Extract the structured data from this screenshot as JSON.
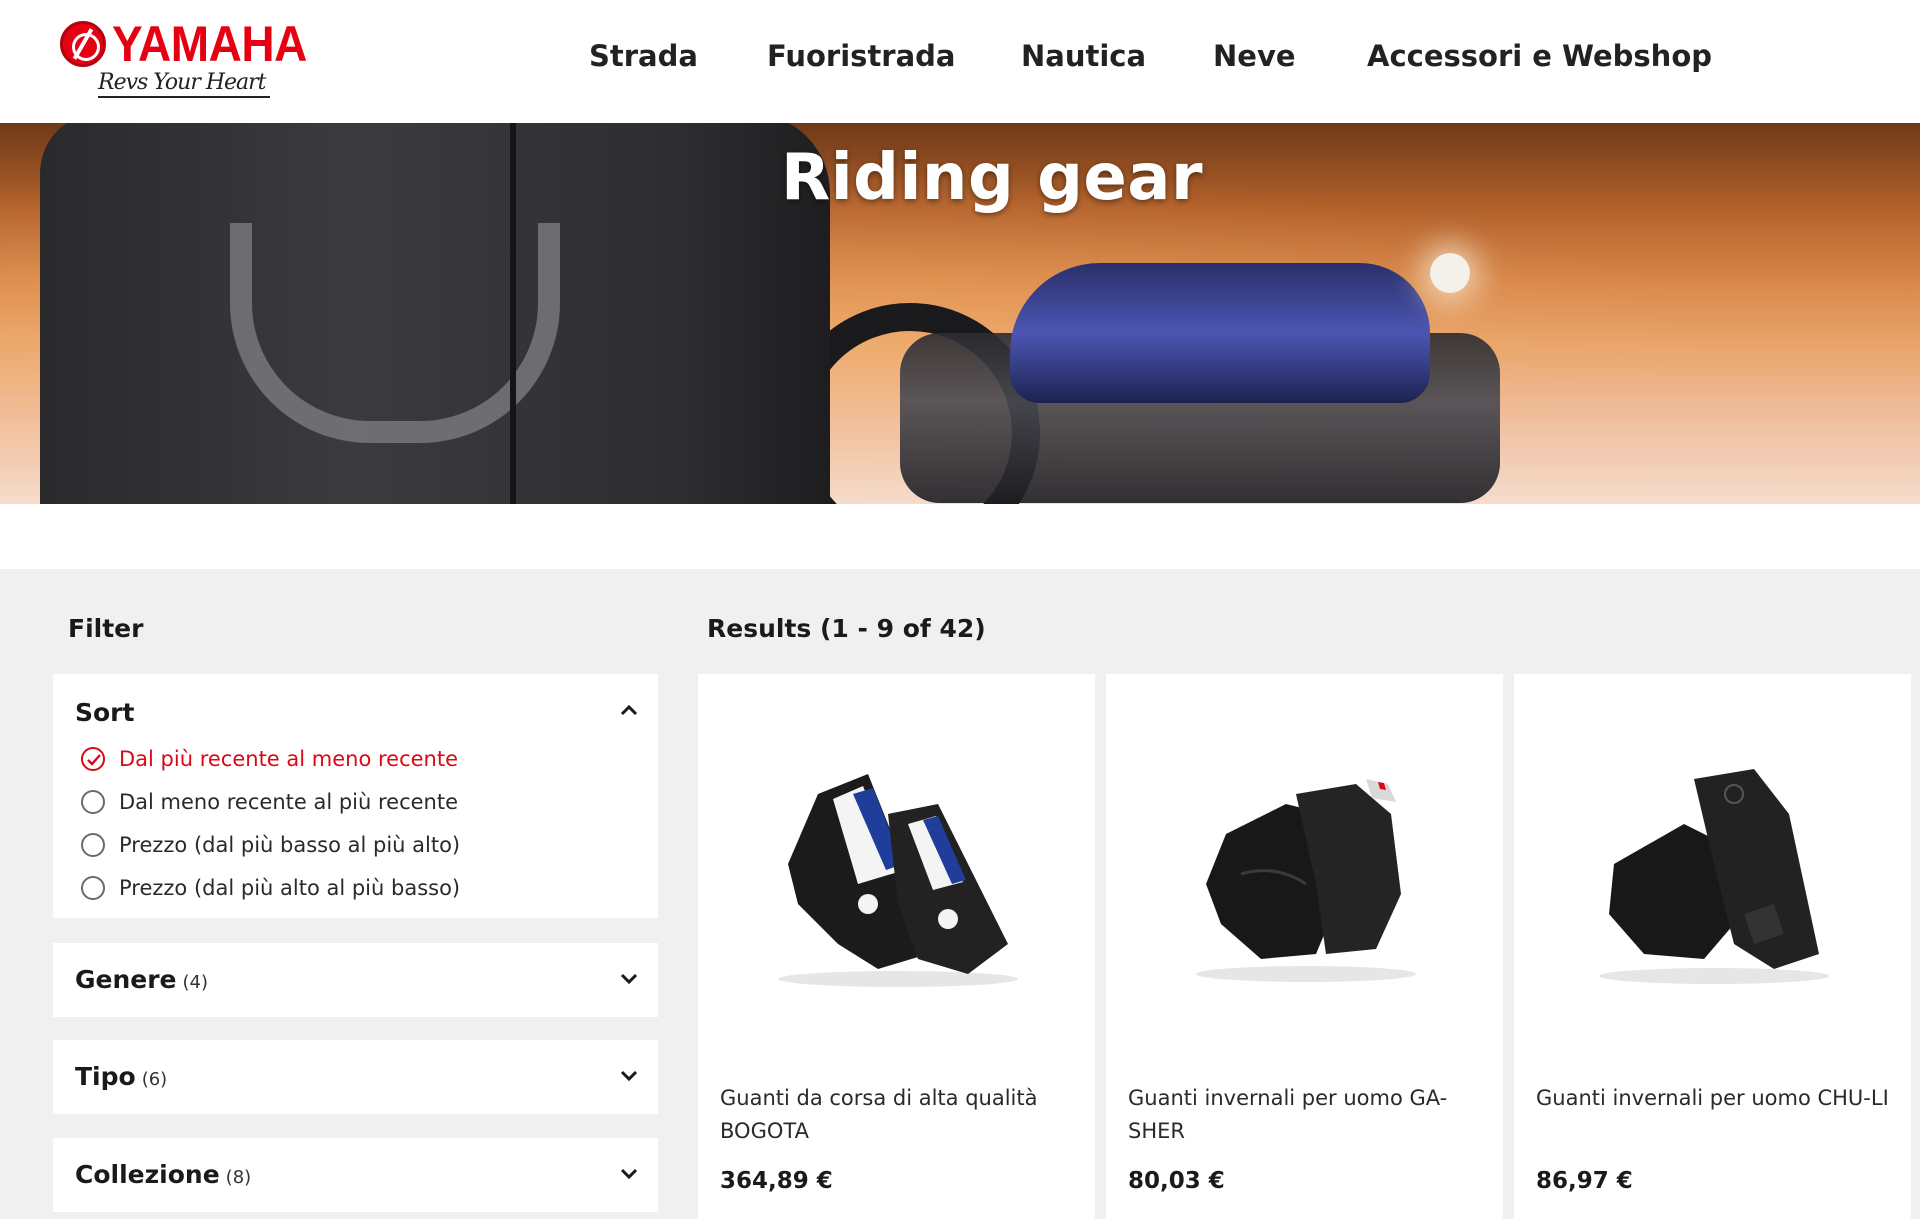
{
  "brand": {
    "name": "YAMAHA",
    "tagline": "Revs Your Heart",
    "color": "#e60012"
  },
  "nav": {
    "items": [
      "Strada",
      "Fuoristrada",
      "Nautica",
      "Neve",
      "Accessori e Webshop"
    ]
  },
  "hero": {
    "title": "Riding gear"
  },
  "filter": {
    "heading": "Filter",
    "sort": {
      "title": "Sort",
      "options": [
        {
          "label": "Dal più recente al meno recente",
          "selected": true
        },
        {
          "label": "Dal meno recente al più recente",
          "selected": false
        },
        {
          "label": "Prezzo (dal più basso al più alto)",
          "selected": false
        },
        {
          "label": "Prezzo (dal più alto al più basso)",
          "selected": false
        }
      ]
    },
    "groups": [
      {
        "title": "Genere",
        "count": "(4)"
      },
      {
        "title": "Tipo",
        "count": "(6)"
      },
      {
        "title": "Collezione",
        "count": "(8)"
      }
    ]
  },
  "results": {
    "heading": "Results (1 - 9 of 42)",
    "products": [
      {
        "name": "Guanti da corsa di alta qualità BOGOTA",
        "price": "364,89 €",
        "image": "racing-gloves-white-black"
      },
      {
        "name": "Guanti invernali per uomo GA-SHER",
        "price": "80,03 €",
        "image": "winter-gloves-black"
      },
      {
        "name": "Guanti invernali per uomo CHU-LI",
        "price": "86,97 €",
        "image": "winter-gloves-black-long"
      }
    ]
  },
  "colors": {
    "accent": "#d90916",
    "section_bg": "#f0f0f0"
  }
}
